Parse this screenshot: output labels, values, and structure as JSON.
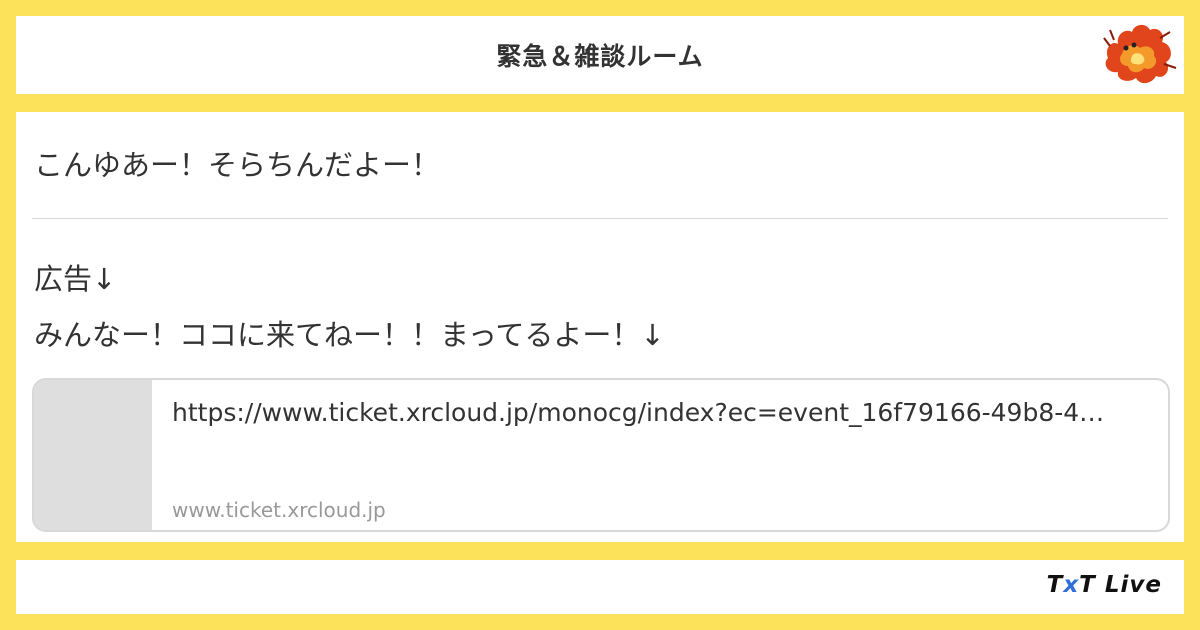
{
  "header": {
    "title": "緊急＆雑談ルーム",
    "avatar_icon": "flame-creature-icon"
  },
  "messages": {
    "greeting": "こんゆあー！そらちんだよー！",
    "ad_label": "広告↓",
    "invite": "みんなー！ココに来てねー！！まってるよー！↓"
  },
  "link_preview": {
    "url": "https://www.ticket.xrcloud.jp/monocg/index?ec=event_16f79166-49b8-4…",
    "domain": "www.ticket.xrcloud.jp"
  },
  "footer": {
    "brand_left": "T",
    "brand_x": "x",
    "brand_right": "T Live"
  },
  "colors": {
    "background": "#FCE15A",
    "panel": "#FFFFFF",
    "text": "#333333",
    "muted": "#999999",
    "brand_accent": "#2E6FD8"
  }
}
